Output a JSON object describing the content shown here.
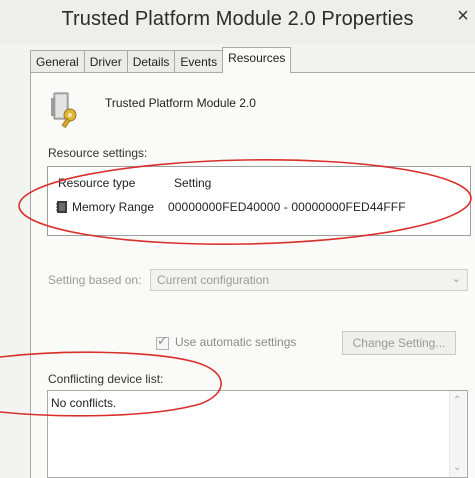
{
  "window": {
    "title": "Trusted Platform Module 2.0 Properties",
    "close_glyph": "×"
  },
  "tabs": [
    {
      "label": "General"
    },
    {
      "label": "Driver"
    },
    {
      "label": "Details"
    },
    {
      "label": "Events"
    },
    {
      "label": "Resources",
      "active": true
    }
  ],
  "device": {
    "name": "Trusted Platform Module 2.0",
    "icon": "security-device-icon"
  },
  "resources": {
    "section_label": "Resource settings:",
    "columns": [
      "Resource type",
      "Setting"
    ],
    "rows": [
      {
        "type": "Memory Range",
        "setting": "00000000FED40000 - 00000000FED44FFF",
        "icon": "chip-icon"
      }
    ]
  },
  "setting_based_on": {
    "label": "Setting based on:",
    "value": "Current configuration"
  },
  "automatic": {
    "label": "Use automatic settings",
    "checked": true
  },
  "change_setting_button": "Change Setting...",
  "conflicts": {
    "label": "Conflicting device list:",
    "value": "No conflicts."
  },
  "colors": {
    "annotation": "#d8302a",
    "disabled_text": "#9a9a9a"
  }
}
